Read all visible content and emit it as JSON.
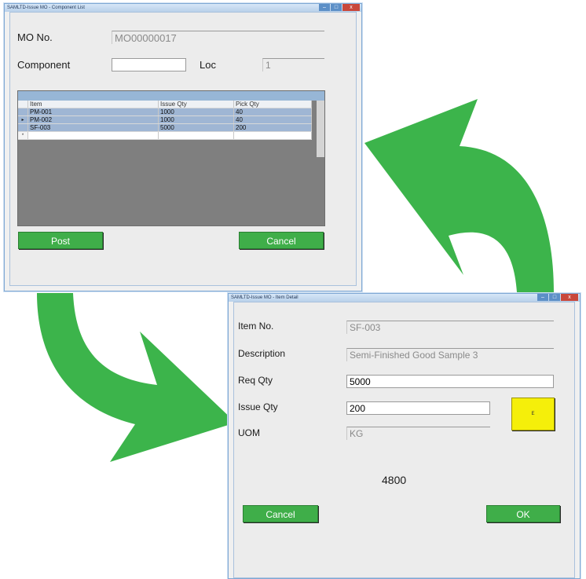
{
  "window1": {
    "title": "SAMLTD-Issue MO - Component List",
    "mo_label": "MO No.",
    "mo_value": "MO00000017",
    "component_label": "Component",
    "component_value": "",
    "loc_label": "Loc",
    "loc_value": "1",
    "grid": {
      "headers": [
        "Item",
        "Issue Qty",
        "Pick Qty"
      ],
      "rows": [
        {
          "item": "PM-001",
          "issue_qty": "1000",
          "pick_qty": "40"
        },
        {
          "item": "PM-002",
          "issue_qty": "1000",
          "pick_qty": "40"
        },
        {
          "item": "SF-003",
          "issue_qty": "5000",
          "pick_qty": "200"
        }
      ],
      "current_row_marker": "▸",
      "new_row_marker": "*"
    },
    "post_label": "Post",
    "cancel_label": "Cancel"
  },
  "window2": {
    "title": "SAMLTD-Issue MO - Item Detail",
    "item_no_label": "Item No.",
    "item_no_value": "SF-003",
    "description_label": "Description",
    "description_value": "Semi-Finished Good Sample 3",
    "req_qty_label": "Req Qty",
    "req_qty_value": "5000",
    "issue_qty_label": "Issue Qty",
    "issue_qty_value": "200",
    "uom_label": "UOM",
    "uom_value": "KG",
    "e_button_label": "E",
    "remaining_value": "4800",
    "cancel_label": "Cancel",
    "ok_label": "OK"
  },
  "window_controls": {
    "min": "–",
    "max": "□",
    "close": "x"
  },
  "colors": {
    "button_green": "#3fae49",
    "arrow_green": "#3cb44b",
    "e_button_yellow": "#f5ef0a",
    "grid_selection": "#9fb6d4"
  }
}
